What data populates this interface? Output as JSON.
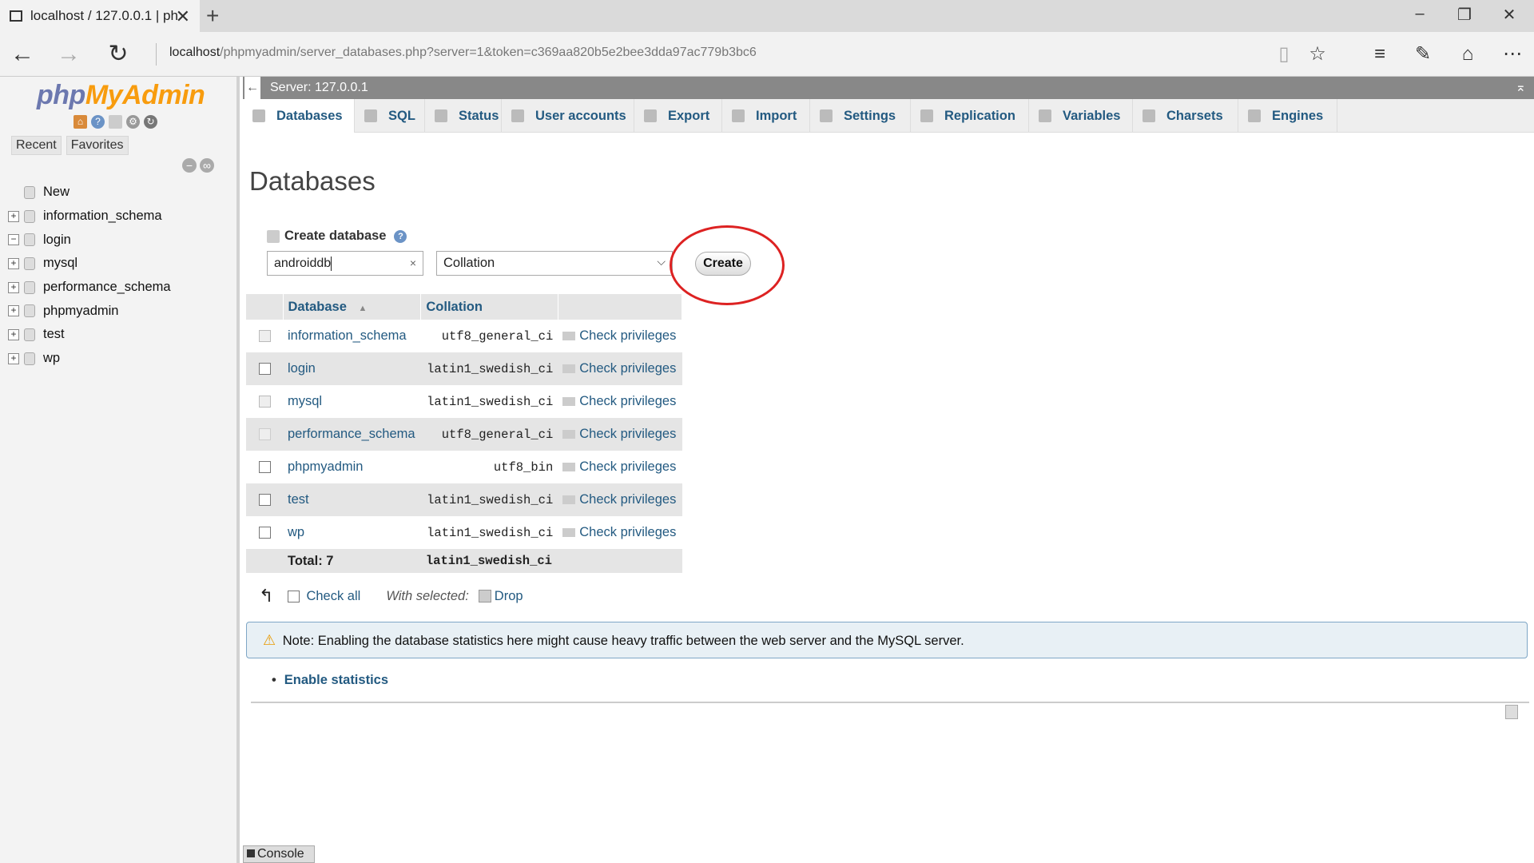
{
  "browser": {
    "tab_title": "localhost / 127.0.0.1 | ph",
    "url_host": "localhost",
    "url_path": "/phpmyadmin/server_databases.php?server=1&token=c369aa820b5e2bee3dda97ac779b3bc6"
  },
  "sidebar": {
    "logo_php": "php",
    "logo_myadmin": "MyAdmin",
    "tabs": [
      "Recent",
      "Favorites"
    ],
    "tree": [
      {
        "label": "New",
        "expander": ""
      },
      {
        "label": "information_schema",
        "expander": "+"
      },
      {
        "label": "login",
        "expander": "−"
      },
      {
        "label": "mysql",
        "expander": "+"
      },
      {
        "label": "performance_schema",
        "expander": "+"
      },
      {
        "label": "phpmyadmin",
        "expander": "+"
      },
      {
        "label": "test",
        "expander": "+"
      },
      {
        "label": "wp",
        "expander": "+"
      }
    ]
  },
  "serverbar": {
    "title": "Server: 127.0.0.1"
  },
  "topmenu": [
    "Databases",
    "SQL",
    "Status",
    "User accounts",
    "Export",
    "Import",
    "Settings",
    "Replication",
    "Variables",
    "Charsets",
    "Engines"
  ],
  "heading": "Databases",
  "create": {
    "label": "Create database",
    "input_value": "androiddb",
    "collation_value": "Collation",
    "button": "Create"
  },
  "table": {
    "headers": {
      "database": "Database",
      "collation": "Collation"
    },
    "sort_indicator": "▲",
    "rows": [
      {
        "name": "information_schema",
        "collation": "utf8_general_ci",
        "action": "Check privileges"
      },
      {
        "name": "login",
        "collation": "latin1_swedish_ci",
        "action": "Check privileges"
      },
      {
        "name": "mysql",
        "collation": "latin1_swedish_ci",
        "action": "Check privileges"
      },
      {
        "name": "performance_schema",
        "collation": "utf8_general_ci",
        "action": "Check privileges"
      },
      {
        "name": "phpmyadmin",
        "collation": "utf8_bin",
        "action": "Check privileges"
      },
      {
        "name": "test",
        "collation": "latin1_swedish_ci",
        "action": "Check privileges"
      },
      {
        "name": "wp",
        "collation": "latin1_swedish_ci",
        "action": "Check privileges"
      }
    ],
    "total_label": "Total: 7",
    "total_collation": "latin1_swedish_ci"
  },
  "bulk": {
    "check_all": "Check all",
    "with_selected": "With selected:",
    "drop": "Drop"
  },
  "note": "Note: Enabling the database statistics here might cause heavy traffic between the web server and the MySQL server.",
  "enable_statistics": "Enable statistics",
  "console": "Console"
}
